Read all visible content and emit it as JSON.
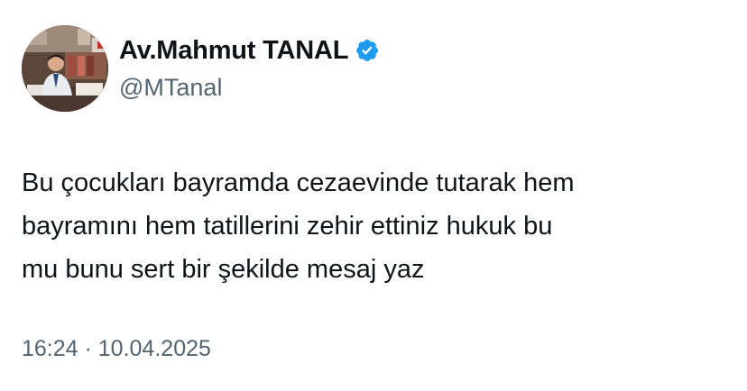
{
  "author": {
    "display_name": "Av.Mahmut TANAL",
    "handle": "@MTanal",
    "verified": true,
    "verified_color": "#1d9bf0",
    "avatar_icon": "profile-photo"
  },
  "tweet": {
    "text": "Bu çocukları bayramda cezaevinde tutarak hem\nbayramını hem tatillerini zehir ettiniz hukuk bu\nmu bunu sert bir şekilde mesaj yaz"
  },
  "meta": {
    "timestamp": "16:24 · 10.04.2025"
  }
}
